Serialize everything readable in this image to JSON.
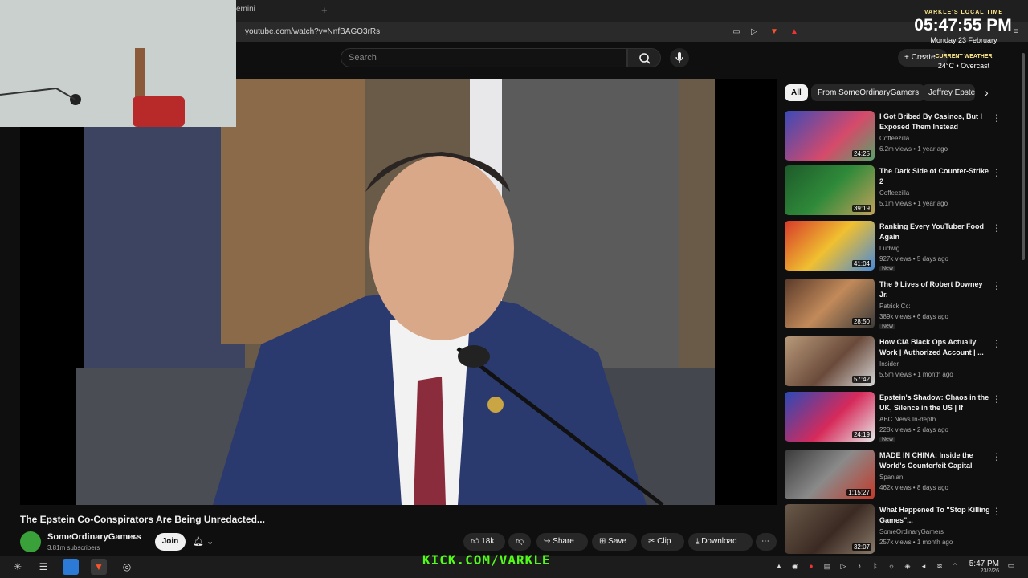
{
  "browser": {
    "tab_title": "emini",
    "new_tab": "+",
    "url": "youtube.com/watch?v=NnfBAGO3rRs"
  },
  "header": {
    "search_placeholder": "Search",
    "create_label": "Create"
  },
  "overlay": {
    "clock_label": "VARKLE'S LOCAL TIME",
    "clock_time": "05:47:55 PM",
    "clock_date": "Monday 23 February",
    "weather_label": "CURRENT WEATHER",
    "weather_value": "24°C • Overcast",
    "kick_text": "KICK.COM/VARKLE"
  },
  "video": {
    "title": "The Epstein Co-Conspirators Are Being Unredacted...",
    "channel": "SomeOrdinaryGamers",
    "subscribers": "3.81m subscribers",
    "join": "Join",
    "likes": "18k",
    "share": "Share",
    "save": "Save",
    "clip": "Clip",
    "download": "Download"
  },
  "chips": [
    "All",
    "From SomeOrdinaryGamers",
    "Jeffrey Epste"
  ],
  "recommendations": [
    {
      "title": "I Got Bribed By Casinos, But I Exposed Them Instead",
      "channel": "Coffeezilla",
      "meta": "6.2m views • 1 year ago",
      "duration": "24:25",
      "badge": ""
    },
    {
      "title": "The Dark Side of Counter-Strike 2",
      "channel": "Coffeezilla",
      "meta": "5.1m views • 1 year ago",
      "duration": "39:19",
      "badge": ""
    },
    {
      "title": "Ranking Every YouTuber Food Again",
      "channel": "Ludwig",
      "meta": "927k views • 5 days ago",
      "duration": "41:04",
      "badge": "New"
    },
    {
      "title": "The 9 Lives of Robert Downey Jr.",
      "channel": "Patrick Cc:",
      "meta": "389k views • 6 days ago",
      "duration": "28:50",
      "badge": "New"
    },
    {
      "title": "How CIA Black Ops Actually Work | Authorized Account | ...",
      "channel": "Insider",
      "meta": "5.5m views • 1 month ago",
      "duration": "57:42",
      "badge": ""
    },
    {
      "title": "Epstein's Shadow: Chaos in the UK, Silence in the US | If You're...",
      "channel": "ABC News In-depth",
      "meta": "228k views • 2 days ago",
      "duration": "24:19",
      "badge": "New"
    },
    {
      "title": "MADE IN CHINA: Inside the World's Counterfeit Capital",
      "channel": "Spanian",
      "meta": "462k views • 8 days ago",
      "duration": "1:15:27",
      "badge": ""
    },
    {
      "title": "What Happened To \"Stop Killing Games\"...",
      "channel": "SomeOrdinaryGamers",
      "meta": "257k views • 1 month ago",
      "duration": "32:07",
      "badge": ""
    }
  ],
  "taskbar": {
    "time": "5:47 PM",
    "date": "23/2/26"
  }
}
